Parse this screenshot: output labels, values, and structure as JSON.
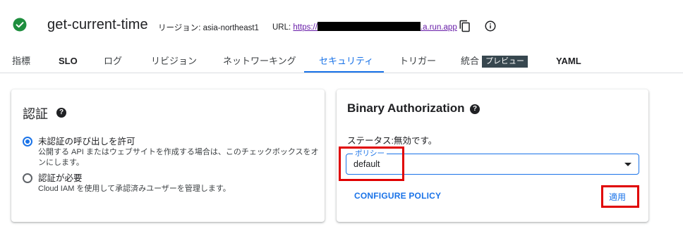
{
  "header": {
    "service_name": "get-current-time",
    "region_text": "リージョン: asia-northeast1",
    "url_label": "URL:",
    "url_prefix": "https://",
    "url_suffix": ".a.run.app",
    "status_icon": "check-circle-icon",
    "copy_icon": "copy-icon",
    "info_icon": "info-icon"
  },
  "tabs": [
    {
      "label": "指標"
    },
    {
      "label": "SLO"
    },
    {
      "label": "ログ"
    },
    {
      "label": "リビジョン"
    },
    {
      "label": "ネットワーキング"
    },
    {
      "label": "セキュリティ"
    },
    {
      "label": "トリガー"
    },
    {
      "label": "統合",
      "badge": "プレビュー"
    },
    {
      "label": "YAML"
    }
  ],
  "auth_card": {
    "title": "認証",
    "help_icon": "help-icon",
    "options": [
      {
        "label": "未認証の呼び出しを許可",
        "description": "公開する API またはウェブサイトを作成する場合は、このチェックボックスをオンにします。",
        "checked": true
      },
      {
        "label": "認証が必要",
        "description": "Cloud IAM を使用して承認済みユーザーを管理します。",
        "checked": false
      }
    ]
  },
  "binary_card": {
    "title": "Binary Authorization",
    "help_icon": "help-icon",
    "status": "ステータス:無効です。",
    "policy_label": "ポリシー",
    "policy_value": "default",
    "configure_label": "CONFIGURE POLICY",
    "apply_label": "適用"
  },
  "colors": {
    "accent": "#1a73e8",
    "success": "#1e8e3e",
    "annotation": "#e00000",
    "badge_bg": "#37474f",
    "link_visited": "#681da8"
  }
}
